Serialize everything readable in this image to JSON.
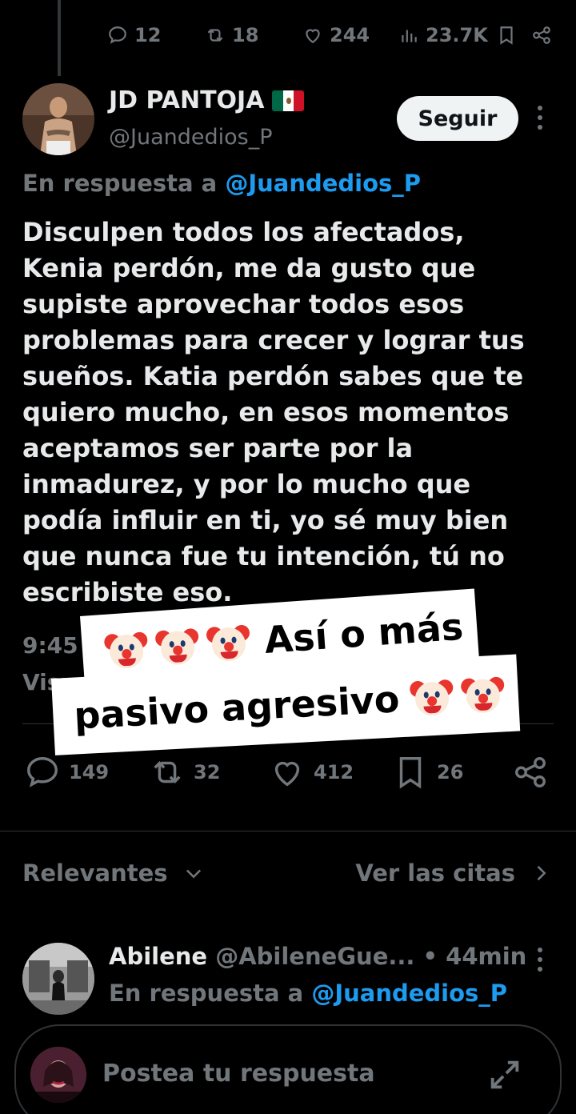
{
  "parent_tweet": {
    "stats": {
      "replies": "12",
      "reposts": "18",
      "likes": "244",
      "views": "23.7K"
    }
  },
  "author": {
    "name": "JD PANTOJA",
    "handle": "@Juandedios_P",
    "follow_label": "Seguir",
    "flag": "mexico-flag-icon"
  },
  "tweet": {
    "reply_prefix": "En respuesta a ",
    "reply_mention": "@Juandedios_P",
    "text": "Disculpen todos los afectados, Kenia perdón, me da gusto que supiste aprovechar todos esos problemas para crecer y lograr tus sueños. Katia perdón sabes que te quiero mucho, en esos momentos aceptamos ser parte por la inmadurez, y por lo mucho que podía influir en ti, yo sé muy bien que  nunca fue tu intención, tú no escribiste eso.",
    "time_partial": "9:45",
    "views_partial": "Visua",
    "stats": {
      "replies": "149",
      "reposts": "32",
      "likes": "412",
      "bookmarks": "26"
    }
  },
  "overlay": {
    "line1": "Así o más",
    "line2": "pasivo agresivo",
    "emoji": "clown-face-icon"
  },
  "section": {
    "left_label": "Relevantes",
    "right_label": "Ver las citas"
  },
  "reply": {
    "name": "Abilene",
    "handle": "@AbileneGue...",
    "separator": " • ",
    "time": "44min",
    "reply_prefix": "En respuesta a ",
    "reply_mention": "@Juandedios_P"
  },
  "compose": {
    "placeholder": "Postea tu respuesta"
  },
  "colors": {
    "background": "#000000",
    "text": "#e7e9ea",
    "muted": "#71767b",
    "accent": "#1d9bf0",
    "follow_bg": "#eff3f4"
  }
}
